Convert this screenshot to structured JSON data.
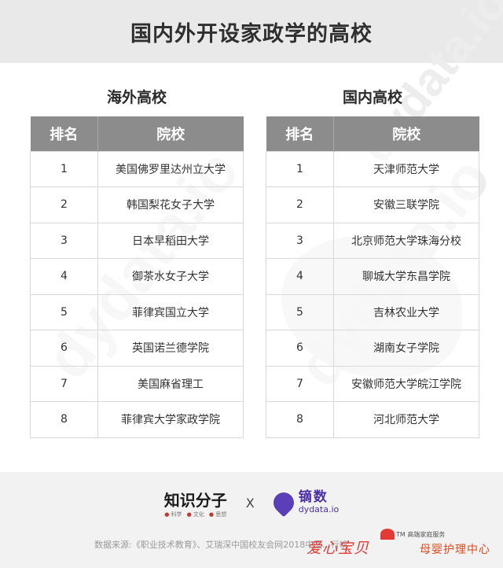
{
  "header": {
    "title": "国内外开设家政学的高校"
  },
  "watermark": {
    "text": "dydata.io"
  },
  "overseas": {
    "title": "海外高校",
    "columns": [
      "排名",
      "院校"
    ],
    "rows": [
      [
        "1",
        "美国佛罗里达州立大学"
      ],
      [
        "2",
        "韩国梨花女子大学"
      ],
      [
        "3",
        "日本早稻田大学"
      ],
      [
        "4",
        "御茶水女子大学"
      ],
      [
        "5",
        "菲律宾国立大学"
      ],
      [
        "6",
        "英国诺兰德学院"
      ],
      [
        "7",
        "美国麻省理工"
      ],
      [
        "8",
        "菲律宾大学家政学院"
      ]
    ]
  },
  "domestic": {
    "title": "国内高校",
    "columns": [
      "排名",
      "院校"
    ],
    "rows": [
      [
        "1",
        "天津师范大学"
      ],
      [
        "2",
        "安徽三联学院"
      ],
      [
        "3",
        "北京师范大学珠海分校"
      ],
      [
        "4",
        "聊城大学东昌学院"
      ],
      [
        "5",
        "吉林农业大学"
      ],
      [
        "6",
        "湖南女子学院"
      ],
      [
        "7",
        "安徽师范大学皖江学院"
      ],
      [
        "8",
        "河北师范大学"
      ]
    ]
  },
  "footer": {
    "logo_zs_name": "知识分子",
    "logo_zs_tags": [
      "科学",
      "文化",
      "思想"
    ],
    "separator": "X",
    "logo_dy_cn": "镝数",
    "logo_dy_en": "dydata.io",
    "source": "数据来源:《职业技术教育》、艾瑞深中国校友会网2018中国...行榜",
    "brand_tm": "TM 高端家庭服务",
    "brand_heart": "爱心宝贝",
    "brand_cn": "母婴护理中心"
  },
  "colors": {
    "header_bg": "#e9e9e9",
    "table_head_bg": "#8c8c8c",
    "brand_red": "#e53935",
    "dy_purple": "#4a2fa6"
  }
}
